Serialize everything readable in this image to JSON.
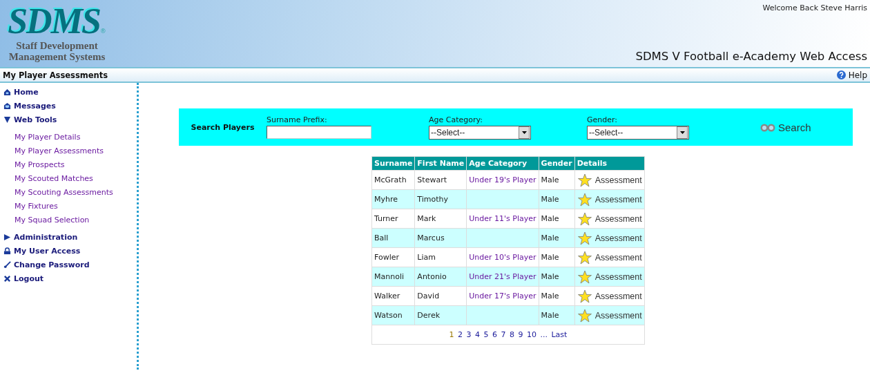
{
  "header": {
    "logo": "SDMS",
    "logo_mark": "®",
    "logo_subtitle": "Staff Development Management Systems",
    "welcome": "Welcome Back Steve Harris",
    "app_title": "SDMS V Football e-Academy Web Access"
  },
  "title_bar": {
    "page_title": "My Player Assessments",
    "help": "Help"
  },
  "sidebar": {
    "items": [
      {
        "label": "Home",
        "kind": "home"
      },
      {
        "label": "Messages",
        "kind": "messages"
      },
      {
        "label": "Web Tools",
        "kind": "folder",
        "expanded": true,
        "children": [
          {
            "label": "My Player Details"
          },
          {
            "label": "My Player Assessments"
          },
          {
            "label": "My Prospects"
          },
          {
            "label": "My Scouted Matches"
          },
          {
            "label": "My Scouting Assessments"
          },
          {
            "label": "My Fixtures"
          },
          {
            "label": "My Squad Selection"
          }
        ]
      },
      {
        "label": "Administration",
        "kind": "folder",
        "expanded": false
      },
      {
        "label": "My User Access",
        "kind": "lock"
      },
      {
        "label": "Change Password",
        "kind": "key"
      },
      {
        "label": "Logout",
        "kind": "logout"
      }
    ]
  },
  "search": {
    "title": "Search Players",
    "surname_label": "Surname Prefix:",
    "age_label": "Age Category:",
    "age_value": "--Select--",
    "gender_label": "Gender:",
    "gender_value": "--Select--",
    "button": "Search"
  },
  "table": {
    "columns": [
      "Surname",
      "First Name",
      "Age Category",
      "Gender",
      "Details"
    ],
    "rows": [
      {
        "surname": "McGrath",
        "first_name": "Stewart",
        "age_category": "Under 19's Player",
        "gender": "Male",
        "details": "Assessment"
      },
      {
        "surname": "Myhre",
        "first_name": "Timothy",
        "age_category": "",
        "gender": "Male",
        "details": "Assessment"
      },
      {
        "surname": "Turner",
        "first_name": "Mark",
        "age_category": "Under 11's Player",
        "gender": "Male",
        "details": "Assessment"
      },
      {
        "surname": "Ball",
        "first_name": "Marcus",
        "age_category": "",
        "gender": "Male",
        "details": "Assessment"
      },
      {
        "surname": "Fowler",
        "first_name": "Liam",
        "age_category": "Under 10's Player",
        "gender": "Male",
        "details": "Assessment"
      },
      {
        "surname": "Mannoli",
        "first_name": "Antonio",
        "age_category": "Under 21's Player",
        "gender": "Male",
        "details": "Assessment"
      },
      {
        "surname": "Walker",
        "first_name": "David",
        "age_category": "Under 17's Player",
        "gender": "Male",
        "details": "Assessment"
      },
      {
        "surname": "Watson",
        "first_name": "Derek",
        "age_category": "",
        "gender": "Male",
        "details": "Assessment"
      }
    ],
    "pager": [
      {
        "label": "1",
        "selected": true
      },
      {
        "label": "2",
        "selected": false
      },
      {
        "label": "3",
        "selected": false
      },
      {
        "label": "4",
        "selected": false
      },
      {
        "label": "5",
        "selected": false
      },
      {
        "label": "6",
        "selected": false
      },
      {
        "label": "7",
        "selected": false
      },
      {
        "label": "8",
        "selected": false
      },
      {
        "label": "9",
        "selected": false
      },
      {
        "label": "10",
        "selected": false
      },
      {
        "label": "...",
        "selected": false
      },
      {
        "label": "Last",
        "selected": false
      }
    ]
  }
}
